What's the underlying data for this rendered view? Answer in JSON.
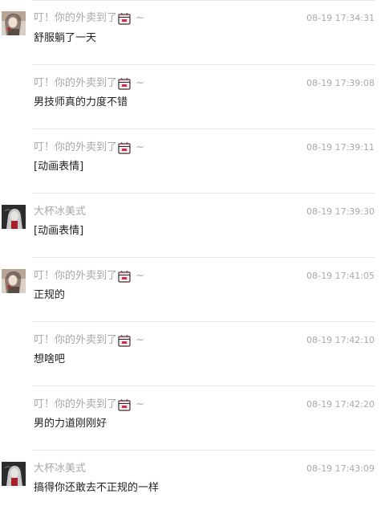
{
  "messages": [
    {
      "sender": "叮！你的外卖到了",
      "tilde": "~",
      "time": "08-19 17:34:31",
      "text": "舒服躺了一天",
      "avatar": "girl-avatar",
      "badge": "takeout-box-icon"
    },
    {
      "sender": "叮！你的外卖到了",
      "tilde": "~",
      "time": "08-19 17:39:08",
      "text": "男技师真的力度不错",
      "avatar": null,
      "badge": "takeout-box-icon"
    },
    {
      "sender": "叮！你的外卖到了",
      "tilde": "~",
      "time": "08-19 17:39:11",
      "text": "[动画表情]",
      "avatar": null,
      "badge": "takeout-box-icon"
    },
    {
      "sender": "大杯冰美式",
      "tilde": "",
      "time": "08-19 17:39:30",
      "text": "[动画表情]",
      "avatar": "dark-avatar",
      "badge": null
    },
    {
      "sender": "叮！你的外卖到了",
      "tilde": "~",
      "time": "08-19 17:41:05",
      "text": "正规的",
      "avatar": "girl-avatar",
      "badge": "takeout-box-icon"
    },
    {
      "sender": "叮！你的外卖到了",
      "tilde": "~",
      "time": "08-19 17:42:10",
      "text": "想啥吧",
      "avatar": null,
      "badge": "takeout-box-icon"
    },
    {
      "sender": "叮！你的外卖到了",
      "tilde": "~",
      "time": "08-19 17:42:20",
      "text": "男的力道刚刚好",
      "avatar": null,
      "badge": "takeout-box-icon"
    },
    {
      "sender": "大杯冰美式",
      "tilde": "",
      "time": "08-19 17:43:09",
      "text": "搞得你还敢去不正规的一样",
      "avatar": "dark-avatar",
      "badge": null
    }
  ],
  "colors": {
    "meta_text": "#a8a8a8",
    "body_text": "#222222",
    "separator": "#e9e9e9",
    "box_red": "#c8324a"
  }
}
